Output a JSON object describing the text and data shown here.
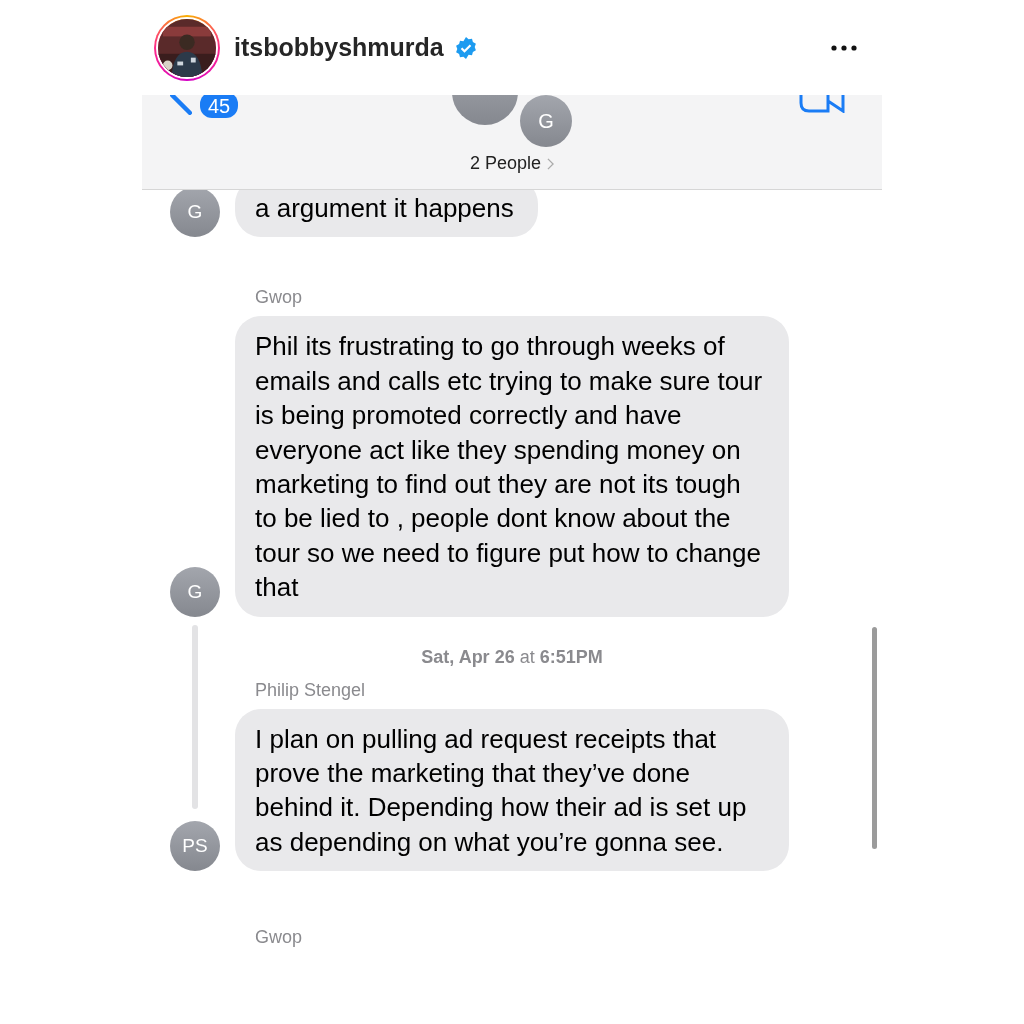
{
  "post_header": {
    "username": "itsbobbyshmurda",
    "verified": true
  },
  "conversation_header": {
    "unread_count": "45",
    "avatar_initials": "G",
    "title": "2 People"
  },
  "messages": [
    {
      "kind": "message",
      "initials": "G",
      "text": "a argument it happens"
    },
    {
      "kind": "message",
      "sender": "Gwop",
      "initials": "G",
      "text": "Phil its frustrating to go through weeks of emails and calls etc trying to make sure tour is being promoted correctly and have everyone act like they spending money on marketing to find out they are not its tough to be lied to , people dont know about the tour so we need to figure put how to change that"
    },
    {
      "kind": "timestamp",
      "text": "**Sat, Apr 26** at **6:51PM**"
    },
    {
      "kind": "message",
      "sender": "Philip Stengel",
      "initials": "PS",
      "text": "I plan on pulling ad request receipts that prove the marketing that they’ve done behind it. Depending how their ad is set up as depending on what you’re gonna see.",
      "threaded": true
    },
    {
      "kind": "sender_label",
      "text": "Gwop"
    }
  ]
}
